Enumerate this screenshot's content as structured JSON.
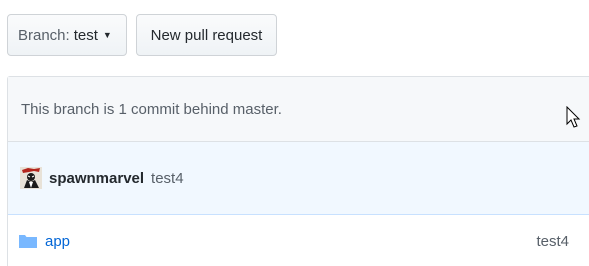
{
  "toolbar": {
    "branch_prefix": "Branch:",
    "branch_name": "test",
    "caret_icon": "triangle-down",
    "new_pr_label": "New pull request"
  },
  "status": {
    "behind_text": "This branch is 1 commit behind master."
  },
  "commit": {
    "avatar_icon": "user-avatar",
    "author": "spawnmarvel",
    "message": "test4"
  },
  "files": [
    {
      "icon": "folder-icon",
      "name": "app",
      "message": "test4"
    }
  ],
  "colors": {
    "link": "#0366d6",
    "commit_bg": "#f1f8ff",
    "status_bg": "#f6f8fa",
    "folder": "#79b8ff"
  }
}
